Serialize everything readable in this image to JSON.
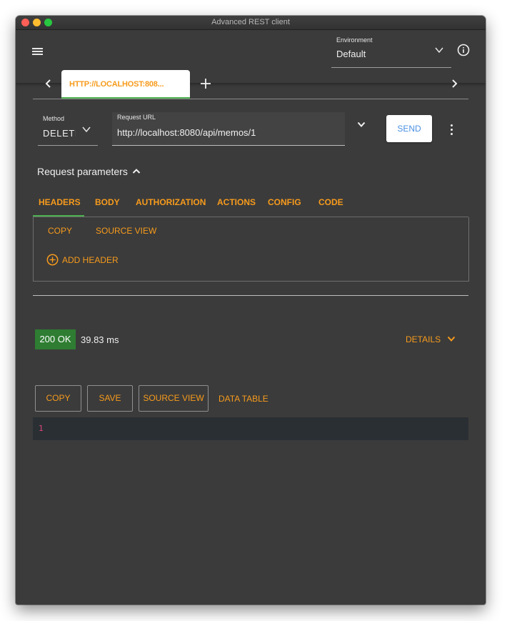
{
  "window": {
    "title": "Advanced REST client"
  },
  "environment": {
    "label": "Environment",
    "value": "Default"
  },
  "tabs": [
    {
      "label": "HTTP://LOCALHOST:808..."
    }
  ],
  "request": {
    "method_label": "Method",
    "method_value": "DELETE",
    "url_label": "Request URL",
    "url_value": "http://localhost:8080/api/memos/1",
    "send_label": "SEND"
  },
  "params": {
    "title": "Request parameters",
    "tabs": [
      "HEADERS",
      "BODY",
      "AUTHORIZATION",
      "ACTIONS",
      "CONFIG",
      "CODE"
    ],
    "active_tab": "HEADERS",
    "copy_label": "COPY",
    "source_view_label": "SOURCE VIEW",
    "add_header_label": "ADD HEADER"
  },
  "response": {
    "status": "200 OK",
    "time": "39.83 ms",
    "details_label": "DETAILS",
    "copy_label": "COPY",
    "save_label": "SAVE",
    "source_view_label": "SOURCE VIEW",
    "data_table_label": "DATA TABLE",
    "line_numbers": [
      "1"
    ]
  },
  "colors": {
    "accent": "#f79b1c",
    "status_ok": "#2e7d32",
    "active_underline": "#4caf50",
    "send_text": "#4a90e2",
    "background": "#3b3b3b"
  }
}
